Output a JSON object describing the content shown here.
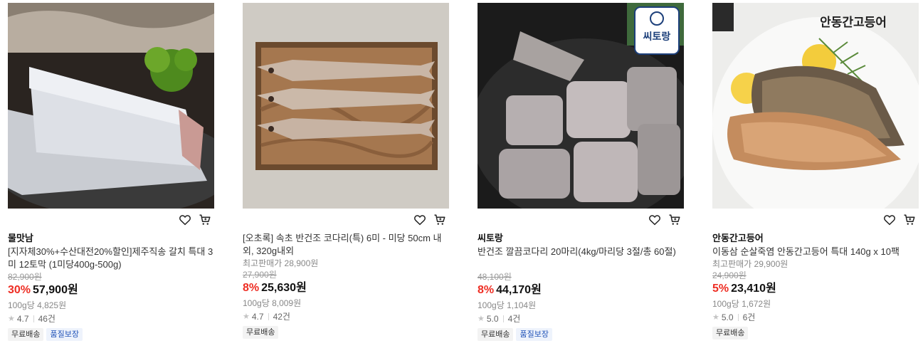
{
  "products": [
    {
      "brand": "물맛남",
      "title": "[지자체30%+수산대전20%할인]제주직송 갈치 특대 3미 12토막 (1미당400g-500g)",
      "reference_price_label": "",
      "original_price": "82,900원",
      "discount": "30%",
      "price": "57,900원",
      "unit_price": "100g당 4,825원",
      "rating": "4.7",
      "reviews": "46건",
      "badges": [
        "무료배송",
        "품질보장"
      ]
    },
    {
      "brand": "",
      "title": "[오초록] 속초 반건조 코다리(특) 6미 - 미당 50cm 내외, 320g내외",
      "reference_price_label": "최고판매가 28,900원",
      "original_price": "27,900원",
      "discount": "8%",
      "price": "25,630원",
      "unit_price": "100g당 8,009원",
      "rating": "4.7",
      "reviews": "42건",
      "badges": [
        "무료배송"
      ]
    },
    {
      "brand": "씨토랑",
      "title": "반건조 깔끔코다리 20마리(4kg/마리당 3절/총 60절)",
      "reference_price_label": "",
      "original_price": "48,100원",
      "discount": "8%",
      "price": "44,170원",
      "unit_price": "100g당 1,104원",
      "rating": "5.0",
      "reviews": "4건",
      "badges": [
        "무료배송",
        "품질보장"
      ]
    },
    {
      "brand": "안동간고등어",
      "title": "이동삼 순살죽염 안동간고등어 특대 140g x 10팩",
      "reference_price_label": "최고판매가 29,900원",
      "original_price": "24,900원",
      "discount": "5%",
      "price": "23,410원",
      "unit_price": "100g당 1,672원",
      "rating": "5.0",
      "reviews": "6건",
      "badges": [
        "무료배송"
      ]
    }
  ],
  "image_overlays": {
    "seatorang_logo": "씨토랑",
    "andong_logo": "안동간고등어"
  },
  "icons": {
    "wishlist": "heart-icon",
    "cart": "cart-icon",
    "rating": "star-icon"
  },
  "colors": {
    "discount": "#ee2e24",
    "quality_badge": "#2153b8"
  }
}
